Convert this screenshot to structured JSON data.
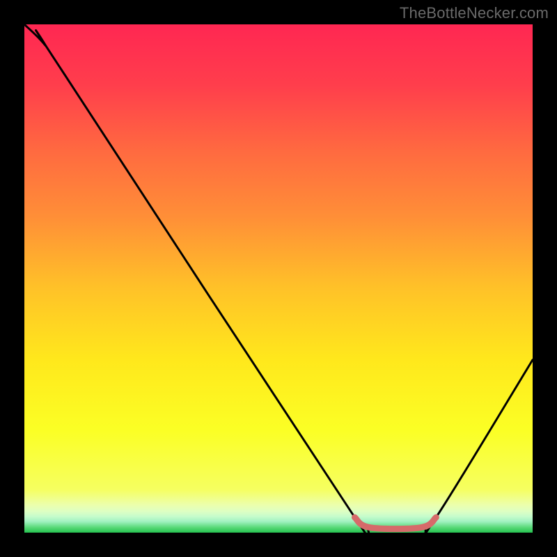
{
  "watermark": "TheBottleNecker.com",
  "chart_data": {
    "type": "line",
    "title": "",
    "xlabel": "",
    "ylabel": "",
    "xlim": [
      0,
      100
    ],
    "ylim": [
      0,
      100
    ],
    "curve": [
      {
        "x": 0,
        "y": 100
      },
      {
        "x": 4,
        "y": 96
      },
      {
        "x": 8,
        "y": 90
      },
      {
        "x": 65,
        "y": 3
      },
      {
        "x": 68,
        "y": 1
      },
      {
        "x": 78,
        "y": 1
      },
      {
        "x": 81,
        "y": 3
      },
      {
        "x": 100,
        "y": 34
      }
    ],
    "highlight": [
      {
        "x": 65,
        "y": 3
      },
      {
        "x": 68,
        "y": 1
      },
      {
        "x": 78,
        "y": 1
      },
      {
        "x": 81,
        "y": 3
      }
    ],
    "gradient_bands": [
      {
        "y": 0.0,
        "color": "#ff2752"
      },
      {
        "y": 0.12,
        "color": "#ff3e4c"
      },
      {
        "y": 0.25,
        "color": "#ff6a40"
      },
      {
        "y": 0.38,
        "color": "#ff8f37"
      },
      {
        "y": 0.52,
        "color": "#ffc228"
      },
      {
        "y": 0.66,
        "color": "#ffe81c"
      },
      {
        "y": 0.8,
        "color": "#fbff25"
      },
      {
        "y": 0.915,
        "color": "#f6ff60"
      },
      {
        "y": 0.945,
        "color": "#ecffab"
      },
      {
        "y": 0.958,
        "color": "#deffc3"
      },
      {
        "y": 0.968,
        "color": "#c6fccb"
      },
      {
        "y": 0.978,
        "color": "#a2f2c2"
      },
      {
        "y": 0.99,
        "color": "#57d877"
      },
      {
        "y": 1.0,
        "color": "#25c24f"
      }
    ]
  }
}
